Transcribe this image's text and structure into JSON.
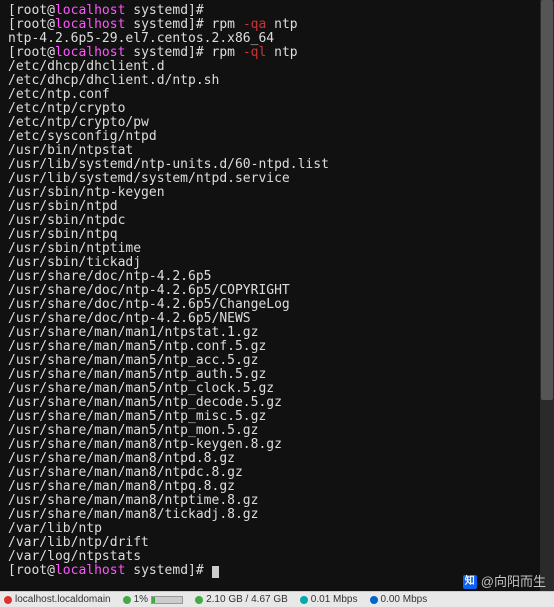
{
  "prompt": {
    "user": "root",
    "at": "@",
    "host": "localhost",
    "path": " systemd",
    "hash": "]# "
  },
  "commands": {
    "empty": "",
    "rpm_qa": {
      "cmd": "rpm ",
      "opt": "-qa",
      "arg": " ntp"
    },
    "rpm_ql": {
      "cmd": "rpm ",
      "opt": "-ql",
      "arg": " ntp"
    }
  },
  "out_qa": "ntp-4.2.6p5-29.el7.centos.2.x86_64",
  "files": [
    "/etc/dhcp/dhclient.d",
    "/etc/dhcp/dhclient.d/ntp.sh",
    "/etc/ntp.conf",
    "/etc/ntp/crypto",
    "/etc/ntp/crypto/pw",
    "/etc/sysconfig/ntpd",
    "/usr/bin/ntpstat",
    "/usr/lib/systemd/ntp-units.d/60-ntpd.list",
    "/usr/lib/systemd/system/ntpd.service",
    "/usr/sbin/ntp-keygen",
    "/usr/sbin/ntpd",
    "/usr/sbin/ntpdc",
    "/usr/sbin/ntpq",
    "/usr/sbin/ntptime",
    "/usr/sbin/tickadj",
    "/usr/share/doc/ntp-4.2.6p5",
    "/usr/share/doc/ntp-4.2.6p5/COPYRIGHT",
    "/usr/share/doc/ntp-4.2.6p5/ChangeLog",
    "/usr/share/doc/ntp-4.2.6p5/NEWS",
    "/usr/share/man/man1/ntpstat.1.gz",
    "/usr/share/man/man5/ntp.conf.5.gz",
    "/usr/share/man/man5/ntp_acc.5.gz",
    "/usr/share/man/man5/ntp_auth.5.gz",
    "/usr/share/man/man5/ntp_clock.5.gz",
    "/usr/share/man/man5/ntp_decode.5.gz",
    "/usr/share/man/man5/ntp_misc.5.gz",
    "/usr/share/man/man5/ntp_mon.5.gz",
    "/usr/share/man/man8/ntp-keygen.8.gz",
    "/usr/share/man/man8/ntpd.8.gz",
    "/usr/share/man/man8/ntpdc.8.gz",
    "/usr/share/man/man8/ntpq.8.gz",
    "/usr/share/man/man8/ntptime.8.gz",
    "/usr/share/man/man8/tickadj.8.gz",
    "/var/lib/ntp",
    "/var/lib/ntp/drift",
    "/var/log/ntpstats"
  ],
  "watermark": {
    "logo": "知",
    "text": "@向阳而生"
  },
  "status": {
    "host": "localhost.localdomain",
    "cpu": "1%",
    "mem": "2.10 GB / 4.67 GB",
    "net1": "0.01 Mbps",
    "net2": "0.00 Mbps"
  }
}
